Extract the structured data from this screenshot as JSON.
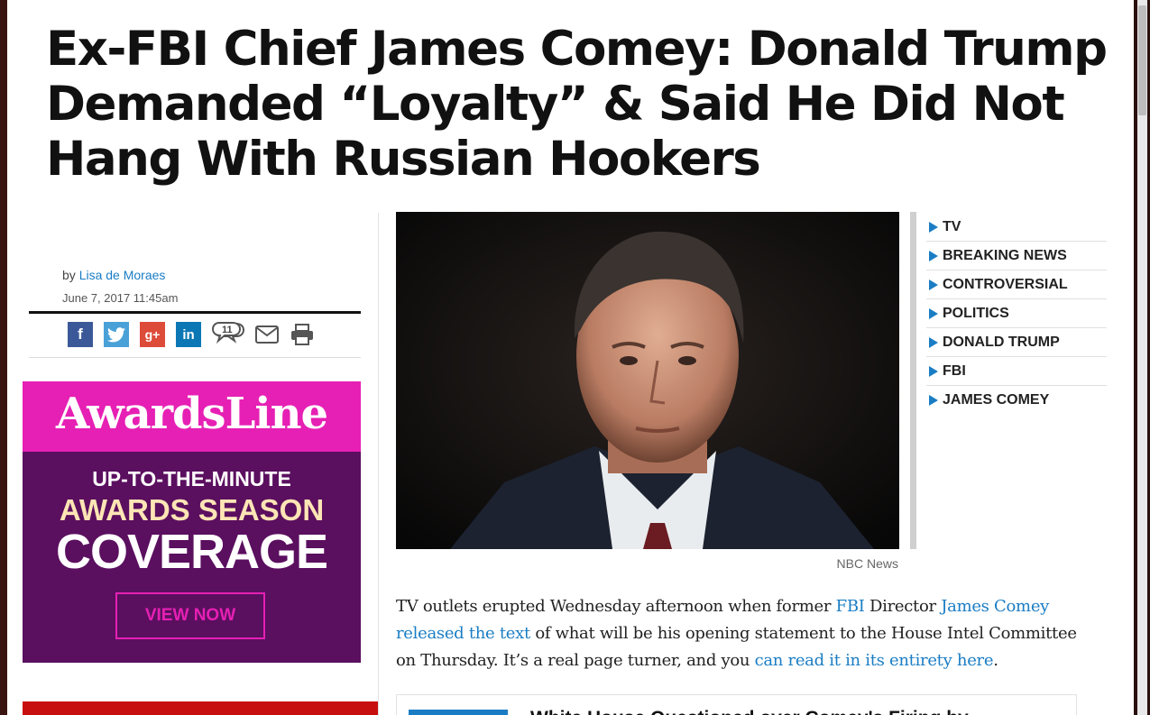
{
  "article": {
    "headline": "Ex-FBI Chief James Comey: Donald Trump Demanded “Loyalty” & Said He Did Not Hang With Russian Hookers",
    "byline_prefix": "by",
    "author": "Lisa de Moraes",
    "date": "June 7, 2017 11:45am",
    "image_caption": "NBC News"
  },
  "share": {
    "facebook_glyph": "f",
    "twitter_icon": "twitter-icon",
    "googleplus_glyph": "g+",
    "linkedin_glyph": "in",
    "comment_count": "11",
    "mail_icon": "mail-icon",
    "print_icon": "print-icon"
  },
  "tags": [
    "TV",
    "BREAKING NEWS",
    "CONTROVERSIAL",
    "POLITICS",
    "DONALD TRUMP",
    "FBI",
    "JAMES COMEY"
  ],
  "ad": {
    "logo": "AwardsLine",
    "line1": "UP-TO-THE-MINUTE",
    "line2": "AWARDS SEASON",
    "line3": "COVERAGE",
    "button": "VIEW NOW"
  },
  "body": {
    "p1_a": "TV outlets erupted Wednesday afternoon when former ",
    "link_fbi": "FBI",
    "p1_b": " Director ",
    "link_comey": "James Comey",
    "p1_c": " ",
    "link_released": "released the text",
    "p1_d": " of what will be his opening statement to the House Intel Committee on Thursday.  It’s a real page turner, and you ",
    "link_read": "can read it in its entirety here",
    "p1_e": "."
  },
  "related": {
    "title": "White House Questioned over Comey's Firing by ..."
  },
  "colors": {
    "link": "#1a7dc4",
    "ad_pink": "#e620b4",
    "ad_purple": "#5b0f5f",
    "tag_arrow": "#1a7dc4"
  }
}
